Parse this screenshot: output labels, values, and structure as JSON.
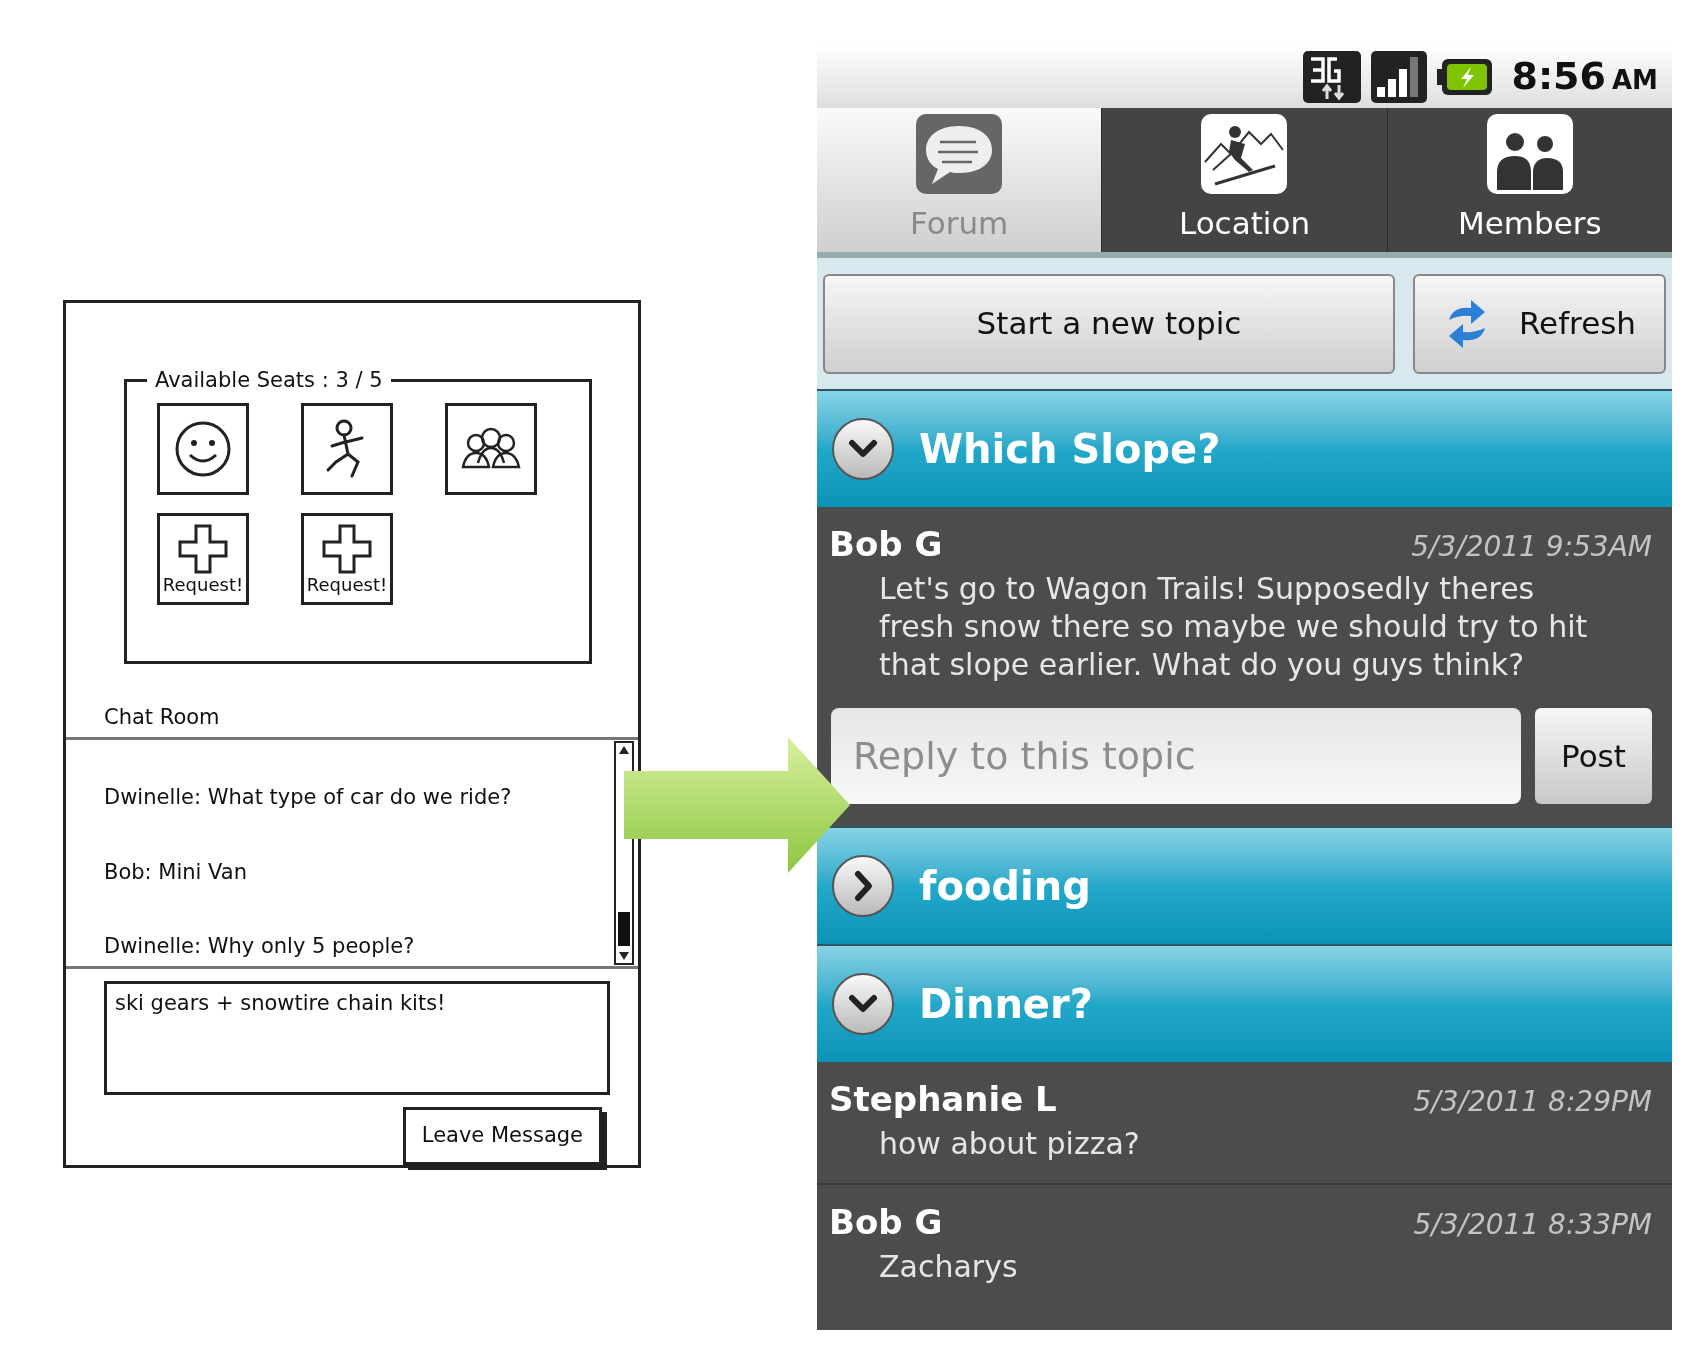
{
  "sketch": {
    "seats": {
      "label": "Available Seats : 3 / 5",
      "slots": [
        {
          "kind": "face"
        },
        {
          "kind": "runner"
        },
        {
          "kind": "group"
        },
        {
          "kind": "request",
          "label": "Request!"
        },
        {
          "kind": "request",
          "label": "Request!"
        }
      ]
    },
    "chat_title": "Chat Room",
    "messages": [
      "Dwinelle: What type of car do we ride?",
      "Bob: Mini Van",
      "Dwinelle: Why only 5 people?"
    ],
    "message_box": {
      "value": "ski gears + snowtire chain kits!"
    },
    "button": "Leave Message"
  },
  "phone": {
    "status_bar": {
      "time": "8:56",
      "ampm": "AM"
    },
    "tabs": [
      {
        "label": "Forum",
        "kind": "forum",
        "selected": true
      },
      {
        "label": "Location",
        "kind": "location",
        "selected": false
      },
      {
        "label": "Members",
        "kind": "members",
        "selected": false
      }
    ],
    "actions": {
      "new_topic": "Start a new topic",
      "refresh": "Refresh"
    },
    "topics": [
      {
        "title": "Which Slope?",
        "expanded": true,
        "posts": [
          {
            "author": "Bob G",
            "time": "5/3/2011 9:53AM",
            "text": "Let's go to Wagon Trails! Supposedly theres fresh snow there so maybe we should try to hit that slope earlier. What do you guys think?"
          }
        ],
        "reply": {
          "placeholder": "Reply to this topic",
          "button": "Post"
        }
      },
      {
        "title": "fooding",
        "expanded": false
      },
      {
        "title": "Dinner?",
        "expanded": true,
        "posts": [
          {
            "author": "Stephanie L",
            "time": "5/3/2011 8:29PM",
            "text": "how about pizza?"
          },
          {
            "author": "Bob G",
            "time": "5/3/2011 8:33PM",
            "text": "Zacharys"
          }
        ]
      }
    ]
  }
}
